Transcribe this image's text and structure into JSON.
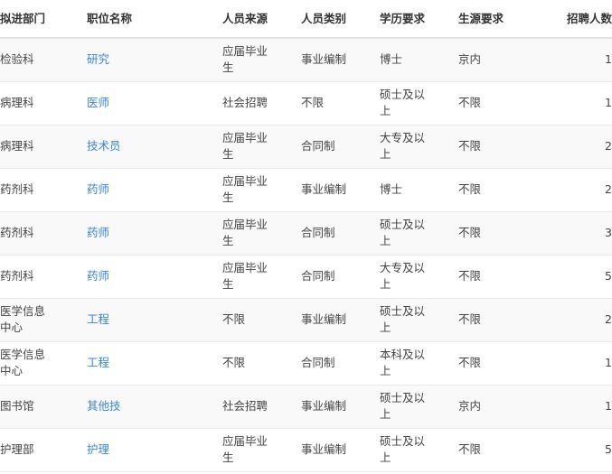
{
  "table": {
    "headers": [
      "拟进部门",
      "职位名称",
      "人员来源",
      "人员类别",
      "学历要求",
      "生源要求",
      "招聘人数"
    ],
    "rows": [
      {
        "dept": "检验科",
        "position": "研究",
        "source": "应届毕业生",
        "category": "事业编制",
        "education": "博士",
        "origin": "京内",
        "count": "1"
      },
      {
        "dept": "病理科",
        "position": "医师",
        "source": "社会招聘",
        "category": "不限",
        "education": "硕士及以上",
        "origin": "不限",
        "count": "1"
      },
      {
        "dept": "病理科",
        "position": "技术员",
        "source": "应届毕业生",
        "category": "合同制",
        "education": "大专及以上",
        "origin": "不限",
        "count": "2"
      },
      {
        "dept": "药剂科",
        "position": "药师",
        "source": "应届毕业生",
        "category": "事业编制",
        "education": "博士",
        "origin": "不限",
        "count": "2"
      },
      {
        "dept": "药剂科",
        "position": "药师",
        "source": "应届毕业生",
        "category": "合同制",
        "education": "硕士及以上",
        "origin": "不限",
        "count": "3"
      },
      {
        "dept": "药剂科",
        "position": "药师",
        "source": "应届毕业生",
        "category": "合同制",
        "education": "大专及以上",
        "origin": "不限",
        "count": "5"
      },
      {
        "dept": "医学信息中心",
        "position": "工程",
        "source": "不限",
        "category": "事业编制",
        "education": "硕士及以上",
        "origin": "不限",
        "count": "2"
      },
      {
        "dept": "医学信息中心",
        "position": "工程",
        "source": "不限",
        "category": "合同制",
        "education": "本科及以上",
        "origin": "不限",
        "count": "1"
      },
      {
        "dept": "图书馆",
        "position": "其他技",
        "source": "社会招聘",
        "category": "事业编制",
        "education": "硕士及以上",
        "origin": "京内",
        "count": "1"
      },
      {
        "dept": "护理部",
        "position": "护理",
        "source": "应届毕业生",
        "category": "事业编制",
        "education": "硕士及以上",
        "origin": "不限",
        "count": "5"
      }
    ]
  },
  "colors": {
    "link": "#3a86d6",
    "row_alt": "#f9f9f9",
    "border": "#e8e8e8",
    "text": "#333333"
  }
}
